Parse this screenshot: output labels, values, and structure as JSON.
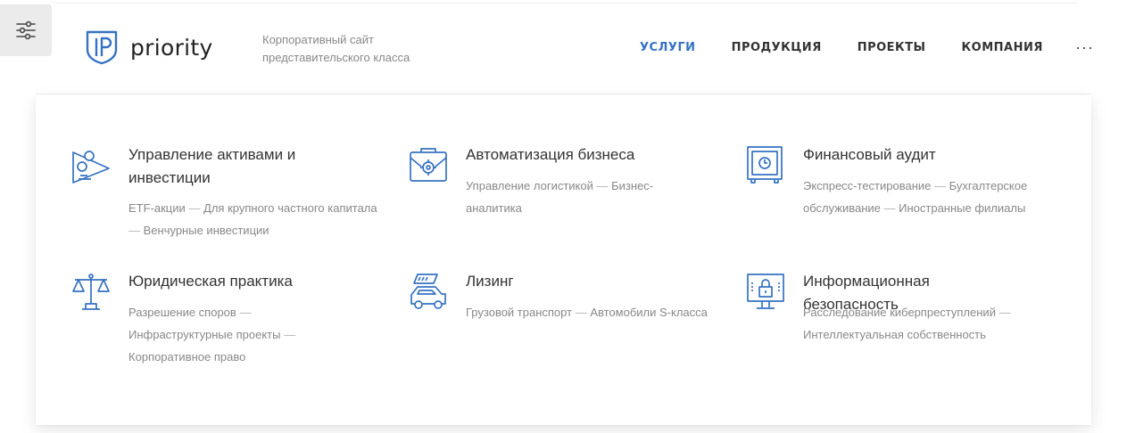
{
  "brand": {
    "name": "priority",
    "tagline": "Корпоративный сайт представительского класса",
    "accent_color": "#3572c2"
  },
  "nav": [
    {
      "label": "УСЛУГИ",
      "active": true
    },
    {
      "label": "ПРОДУКЦИЯ",
      "active": false
    },
    {
      "label": "ПРОЕКТЫ",
      "active": false
    },
    {
      "label": "КОМПАНИЯ",
      "active": false
    }
  ],
  "more_label": "···",
  "services": [
    {
      "icon": "assets-investment-icon",
      "title": "Управление активами и инвестиции",
      "subs": [
        "ETF-акции",
        "Для крупного частного капитала",
        "Венчурные инвестиции"
      ]
    },
    {
      "icon": "briefcase-gear-icon",
      "title": "Автоматизация бизнеса",
      "subs": [
        "Управление логистикой",
        "Бизнес-аналитика"
      ]
    },
    {
      "icon": "safe-icon",
      "title": "Финансовый аудит",
      "subs": [
        "Экспресс-тестирование",
        "Бухгалтерское обслуживание",
        "Иностранные филиалы"
      ]
    },
    {
      "icon": "scales-icon",
      "title": "Юридическая практика",
      "subs": [
        "Разрешение споров",
        "Инфраструктурные проекты",
        "Корпоративное право"
      ]
    },
    {
      "icon": "car-icon",
      "title": "Лизинг",
      "subs": [
        "Грузовой транспорт",
        "Автомобили S-класса"
      ]
    },
    {
      "icon": "monitor-lock-icon",
      "title": "Информационная безопасность",
      "subs": [
        "Расследование киберпреступлений",
        "Интеллектуальная собственность"
      ]
    }
  ]
}
